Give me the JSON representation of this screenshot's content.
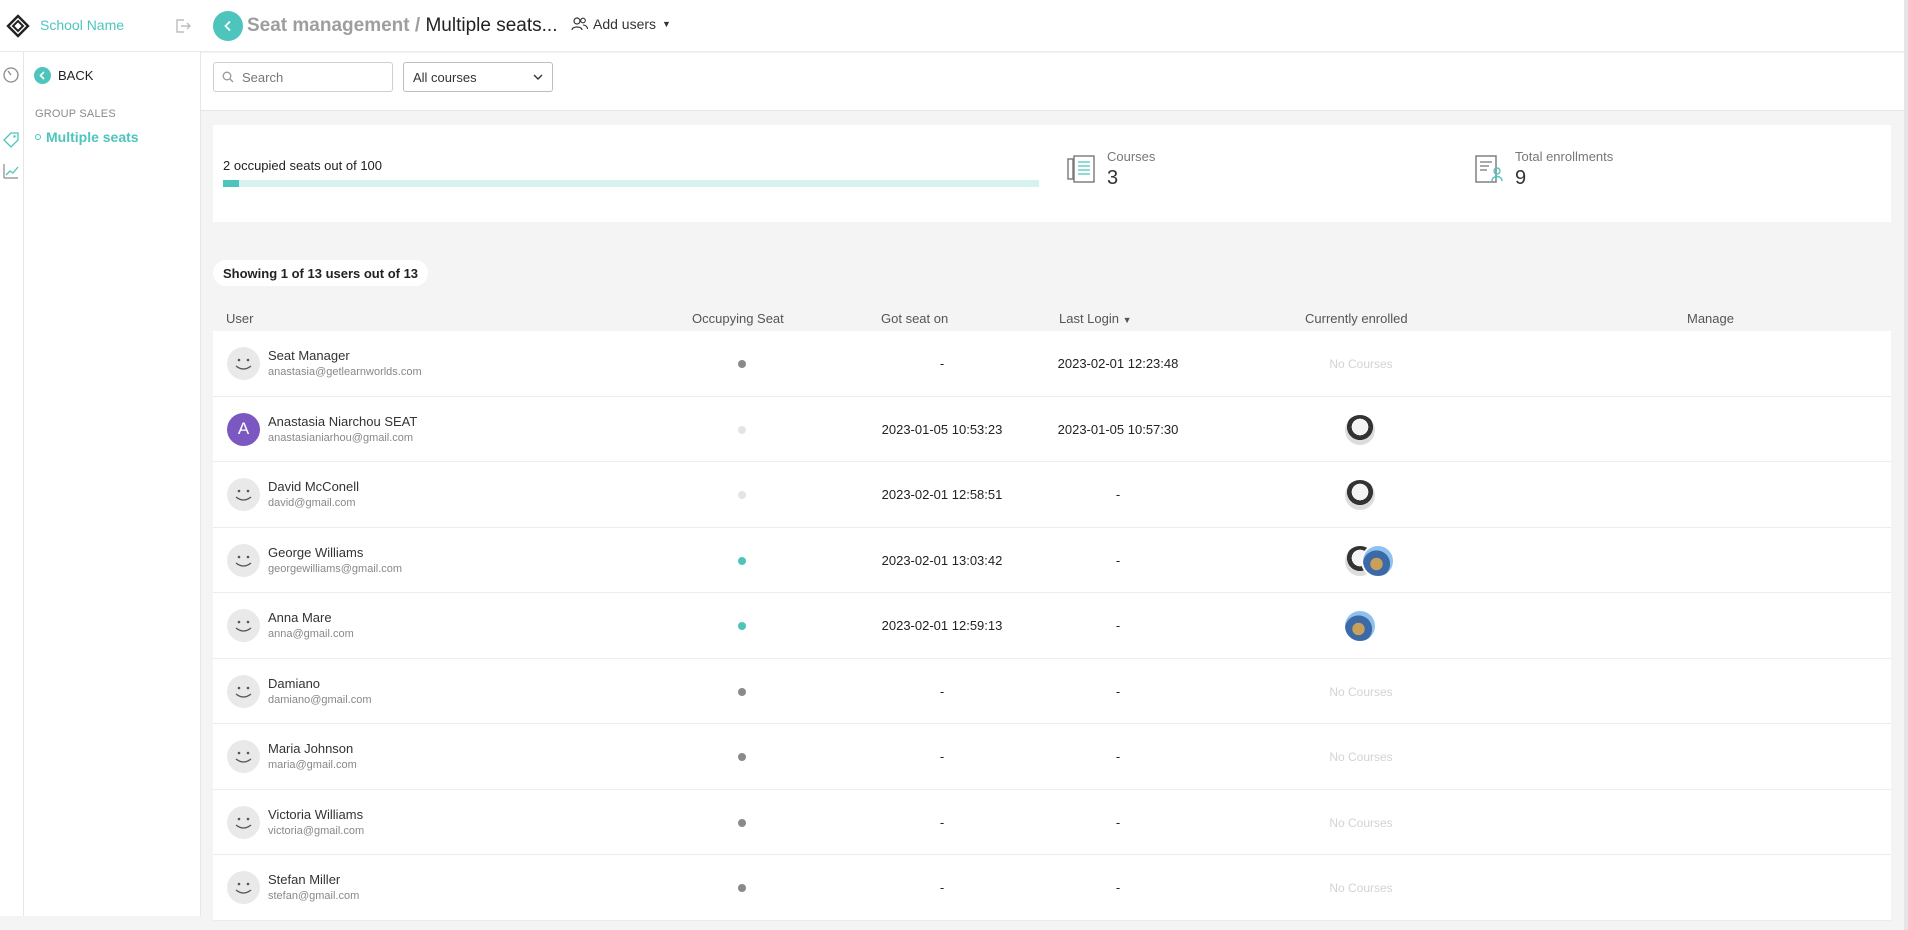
{
  "app": {
    "school_name": "School Name",
    "accent_color": "#4ec5bc"
  },
  "sidebar": {
    "back_label": "BACK",
    "group_label": "GROUP SALES",
    "items": [
      {
        "label": "Multiple seats",
        "active": true
      }
    ],
    "rail_icons": [
      "dashboard-icon",
      "tag-icon",
      "chart-icon"
    ]
  },
  "header": {
    "breadcrumb_parent": "Seat management",
    "breadcrumb_separator": " / ",
    "breadcrumb_current": "Multiple seats...",
    "add_users_label": "Add users"
  },
  "filters": {
    "search_placeholder": "Search",
    "course_select_value": "All courses"
  },
  "stats": {
    "seats_text": "2 occupied seats out of 100",
    "occupied_seats": 2,
    "total_seats": 100,
    "courses_label": "Courses",
    "courses_value": "3",
    "enrollments_label": "Total enrollments",
    "enrollments_value": "9"
  },
  "table": {
    "showing_text": "Showing 1 of 13 users out of 13",
    "columns": {
      "user": "User",
      "occupying": "Occupying Seat",
      "got_seat": "Got seat on",
      "last_login": "Last Login",
      "enrolled": "Currently enrolled",
      "manage": "Manage"
    },
    "rows": [
      {
        "name": "Seat Manager",
        "email": "anastasia@getlearnworlds.com",
        "avatar": "smile",
        "seat": "inactive",
        "got_seat": "-",
        "last_login": "2023-02-01 12:23:48",
        "courses": [],
        "no_courses": "No Courses"
      },
      {
        "name": "Anastasia Niarchou SEAT",
        "email": "anastasianiarhou@gmail.com",
        "avatar": "A",
        "seat": "none",
        "got_seat": "2023-01-05 10:53:23",
        "last_login": "2023-01-05 10:57:30",
        "courses": [
          "mtn"
        ]
      },
      {
        "name": "David McConell",
        "email": "david@gmail.com",
        "avatar": "smile",
        "seat": "none",
        "got_seat": "2023-02-01 12:58:51",
        "last_login": "-",
        "courses": [
          "mtn"
        ]
      },
      {
        "name": "George Williams",
        "email": "georgewilliams@gmail.com",
        "avatar": "smile",
        "seat": "active",
        "got_seat": "2023-02-01 13:03:42",
        "last_login": "-",
        "courses": [
          "mtn",
          "sea"
        ]
      },
      {
        "name": "Anna Mare",
        "email": "anna@gmail.com",
        "avatar": "smile",
        "seat": "active",
        "got_seat": "2023-02-01 12:59:13",
        "last_login": "-",
        "courses": [
          "sea"
        ]
      },
      {
        "name": "Damiano",
        "email": "damiano@gmail.com",
        "avatar": "smile",
        "seat": "inactive",
        "got_seat": "-",
        "last_login": "-",
        "courses": [],
        "no_courses": "No Courses"
      },
      {
        "name": "Maria Johnson",
        "email": "maria@gmail.com",
        "avatar": "smile",
        "seat": "inactive",
        "got_seat": "-",
        "last_login": "-",
        "courses": [],
        "no_courses": "No Courses"
      },
      {
        "name": "Victoria Williams",
        "email": "victoria@gmail.com",
        "avatar": "smile",
        "seat": "inactive",
        "got_seat": "-",
        "last_login": "-",
        "courses": [],
        "no_courses": "No Courses"
      },
      {
        "name": "Stefan Miller",
        "email": "stefan@gmail.com",
        "avatar": "smile",
        "seat": "inactive",
        "got_seat": "-",
        "last_login": "-",
        "courses": [],
        "no_courses": "No Courses"
      }
    ]
  },
  "colors": {
    "seat_active": "#4ec5bc",
    "seat_inactive": "#8a8a8a",
    "seat_none": "#e4e4e4",
    "letter_avatar": "#7b57c2"
  }
}
